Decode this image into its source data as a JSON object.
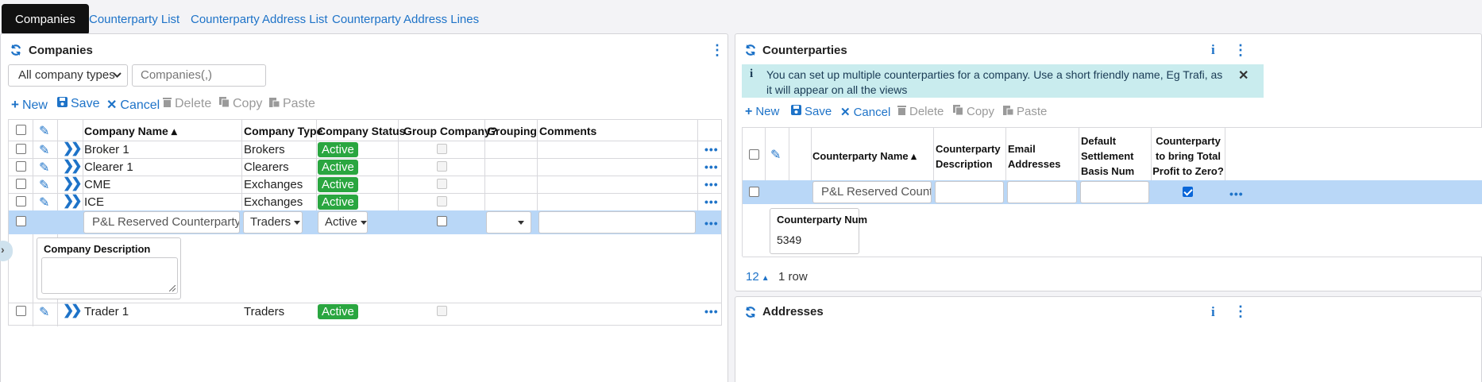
{
  "tabs": [
    "Companies",
    "Counterparty List",
    "Counterparty Address List",
    "Counterparty Address Lines"
  ],
  "companies": {
    "title": "Companies",
    "filter_select": "All company types",
    "search_placeholder": "Companies(,)",
    "toolbar": {
      "new": "New",
      "save": "Save",
      "cancel": "Cancel",
      "delete": "Delete",
      "copy": "Copy",
      "paste": "Paste"
    },
    "columns": [
      "Company Name ▴",
      "Company Type",
      "Company Status",
      "Group Company?",
      "Grouping",
      "Comments"
    ],
    "rows": [
      {
        "name": "Broker 1",
        "type": "Brokers",
        "status": "Active"
      },
      {
        "name": "Clearer 1",
        "type": "Clearers",
        "status": "Active"
      },
      {
        "name": "CME",
        "type": "Exchanges",
        "status": "Active"
      },
      {
        "name": "ICE",
        "type": "Exchanges",
        "status": "Active"
      }
    ],
    "edit_row": {
      "name": "P&L Reserved Counterparty",
      "type": "Traders",
      "status": "Active"
    },
    "description_label": "Company Description",
    "last_row": {
      "name": "Trader 1",
      "type": "Traders",
      "status": "Active"
    }
  },
  "counterparties": {
    "title": "Counterparties",
    "info_text": "You can set up multiple counterparties for a company. Use a short friendly name, Eg Trafi, as it will appear on all the views",
    "toolbar": {
      "new": "New",
      "save": "Save",
      "cancel": "Cancel",
      "delete": "Delete",
      "copy": "Copy",
      "paste": "Paste"
    },
    "columns": [
      "Counterparty Name ▴",
      "Counterparty Description",
      "Email Addresses",
      "Default Settlement Basis Num",
      "Counterparty to bring Total Profit to Zero?"
    ],
    "edit_row": {
      "name": "P&L Reserved Counterparty",
      "profit_zero": true
    },
    "num_label": "Counterparty Num",
    "num_value": "5349",
    "page_size": "12",
    "row_count": "1 row"
  },
  "addresses": {
    "title": "Addresses"
  },
  "icons": [
    "refresh-icon",
    "kebab-icon",
    "info-icon",
    "close-icon",
    "plus-icon",
    "floppy-icon",
    "x-icon",
    "trash-icon",
    "copy-icon",
    "paste-icon",
    "pencil-icon",
    "double-chevron-icon",
    "ellipsis-icon",
    "caret-icon"
  ]
}
